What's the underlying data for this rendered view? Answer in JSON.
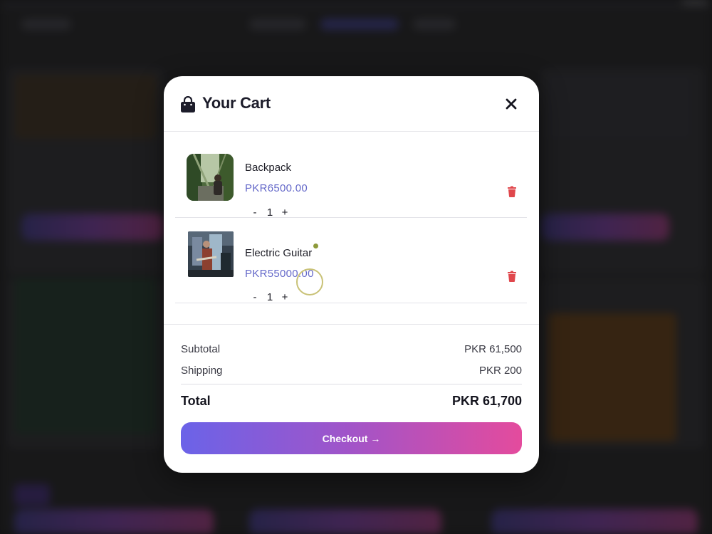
{
  "cart": {
    "title": "Your Cart",
    "icon": "shopping-bag-icon",
    "close_icon": "close-icon",
    "items": [
      {
        "name": "Backpack",
        "price": "PKR6500.00",
        "quantity": "1",
        "decrement": "-",
        "increment": "+"
      },
      {
        "name": "Electric Guitar",
        "price": "PKR55000.00",
        "quantity": "1",
        "decrement": "-",
        "increment": "+"
      }
    ],
    "summary": {
      "subtotal_label": "Subtotal",
      "subtotal_value": "PKR 61,500",
      "shipping_label": "Shipping",
      "shipping_value": "PKR 200",
      "total_label": "Total",
      "total_value": "PKR 61,700"
    },
    "checkout_label": "Checkout →"
  },
  "colors": {
    "price": "#6468c9",
    "trash": "#e0474c",
    "checkout_gradient_start": "#6b63e8",
    "checkout_gradient_end": "#e44b9d"
  }
}
